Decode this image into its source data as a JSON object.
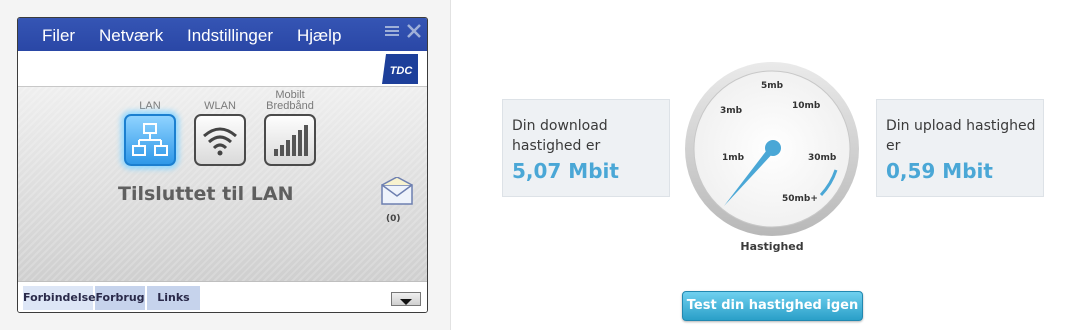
{
  "app": {
    "menu": {
      "filer": "Filer",
      "netvaerk": "Netværk",
      "indstillinger": "Indstillinger",
      "hjaelp": "Hjælp"
    },
    "logo_text": "TDC",
    "connections": {
      "lan": "LAN",
      "wlan": "WLAN",
      "mobile_line1": "Mobilt",
      "mobile_line2": "Bredbånd"
    },
    "status": "Tilsluttet til LAN",
    "messages_count": "(0)",
    "tabs": {
      "forbindelse": "Forbindelse",
      "forbrug": "Forbrug",
      "links": "Links"
    }
  },
  "speedtest": {
    "download_label": "Din download hastighed er",
    "download_value": "5,07 Mbit",
    "upload_label": "Din upload hastighed er",
    "upload_value": "0,59 Mbit",
    "gauge": {
      "ticks": [
        "1mb",
        "3mb",
        "5mb",
        "10mb",
        "30mb",
        "50mb+"
      ],
      "caption": "Hastighed"
    },
    "test_button": "Test din hastighed igen"
  },
  "colors": {
    "menubar": "#2a47a6",
    "accent": "#4aa7d6",
    "button": "#2a9fc8"
  }
}
